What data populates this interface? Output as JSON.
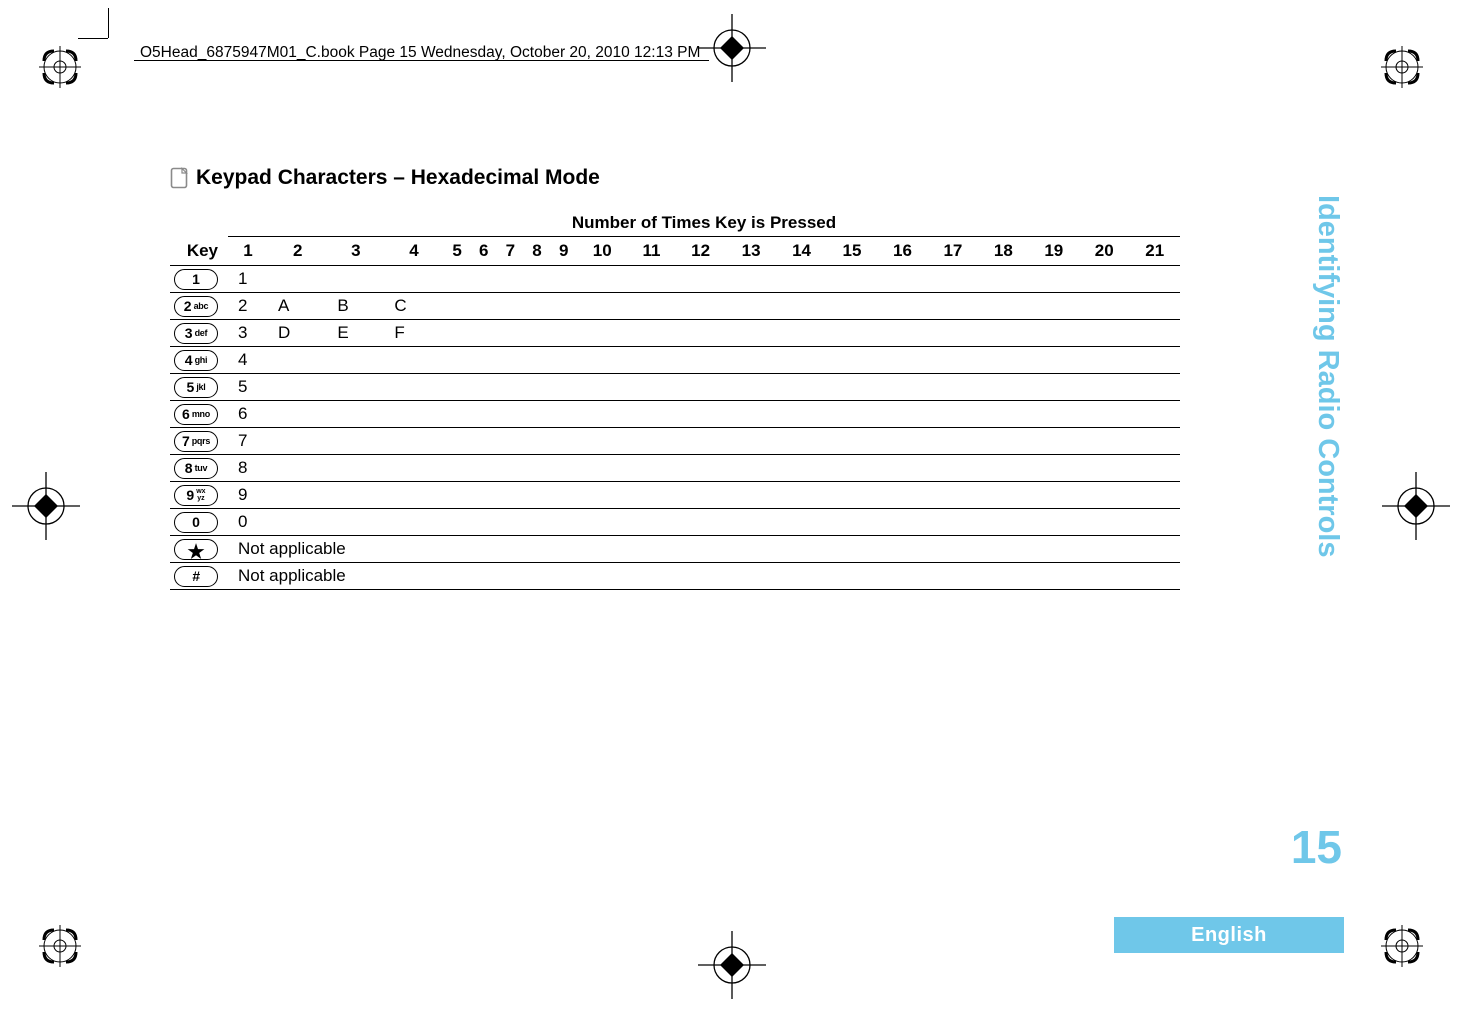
{
  "header": {
    "running_title": "O5Head_6875947M01_C.book  Page 15  Wednesday, October 20, 2010  12:13 PM"
  },
  "heading": "Keypad Characters – Hexadecimal Mode",
  "table": {
    "super_header": "Number of Times Key is Pressed",
    "key_header": "Key",
    "columns": [
      "1",
      "2",
      "3",
      "4",
      "5",
      "6",
      "7",
      "8",
      "9",
      "10",
      "11",
      "12",
      "13",
      "14",
      "15",
      "16",
      "17",
      "18",
      "19",
      "20",
      "21"
    ],
    "rows": [
      {
        "main": "1",
        "sub": "",
        "cells": [
          "1",
          "",
          "",
          "",
          "",
          "",
          "",
          "",
          "",
          "",
          "",
          "",
          "",
          "",
          "",
          "",
          "",
          "",
          "",
          "",
          ""
        ]
      },
      {
        "main": "2",
        "sub": "abc",
        "cells": [
          "2",
          "A",
          "B",
          "C",
          "",
          "",
          "",
          "",
          "",
          "",
          "",
          "",
          "",
          "",
          "",
          "",
          "",
          "",
          "",
          "",
          ""
        ]
      },
      {
        "main": "3",
        "sub": "def",
        "cells": [
          "3",
          "D",
          "E",
          "F",
          "",
          "",
          "",
          "",
          "",
          "",
          "",
          "",
          "",
          "",
          "",
          "",
          "",
          "",
          "",
          "",
          ""
        ]
      },
      {
        "main": "4",
        "sub": "ghi",
        "cells": [
          "4",
          "",
          "",
          "",
          "",
          "",
          "",
          "",
          "",
          "",
          "",
          "",
          "",
          "",
          "",
          "",
          "",
          "",
          "",
          "",
          ""
        ]
      },
      {
        "main": "5",
        "sub": "jkl",
        "cells": [
          "5",
          "",
          "",
          "",
          "",
          "",
          "",
          "",
          "",
          "",
          "",
          "",
          "",
          "",
          "",
          "",
          "",
          "",
          "",
          "",
          ""
        ]
      },
      {
        "main": "6",
        "sub": "mno",
        "cells": [
          "6",
          "",
          "",
          "",
          "",
          "",
          "",
          "",
          "",
          "",
          "",
          "",
          "",
          "",
          "",
          "",
          "",
          "",
          "",
          "",
          ""
        ]
      },
      {
        "main": "7",
        "sub": "pqrs",
        "cells": [
          "7",
          "",
          "",
          "",
          "",
          "",
          "",
          "",
          "",
          "",
          "",
          "",
          "",
          "",
          "",
          "",
          "",
          "",
          "",
          "",
          ""
        ]
      },
      {
        "main": "8",
        "sub": "tuv",
        "cells": [
          "8",
          "",
          "",
          "",
          "",
          "",
          "",
          "",
          "",
          "",
          "",
          "",
          "",
          "",
          "",
          "",
          "",
          "",
          "",
          "",
          ""
        ]
      },
      {
        "main": "9",
        "substack": [
          "wx",
          "yz"
        ],
        "cells": [
          "9",
          "",
          "",
          "",
          "",
          "",
          "",
          "",
          "",
          "",
          "",
          "",
          "",
          "",
          "",
          "",
          "",
          "",
          "",
          "",
          ""
        ]
      },
      {
        "main": "0",
        "sub": "",
        "cells": [
          "0",
          "",
          "",
          "",
          "",
          "",
          "",
          "",
          "",
          "",
          "",
          "",
          "",
          "",
          "",
          "",
          "",
          "",
          "",
          "",
          ""
        ]
      },
      {
        "main": "★",
        "sub": "",
        "span": "Not applicable"
      },
      {
        "main": "#",
        "sub": "",
        "span": "Not applicable"
      }
    ]
  },
  "side": {
    "section_label": "Identifying Radio Controls",
    "page_number": "15",
    "footer_language": "English"
  }
}
